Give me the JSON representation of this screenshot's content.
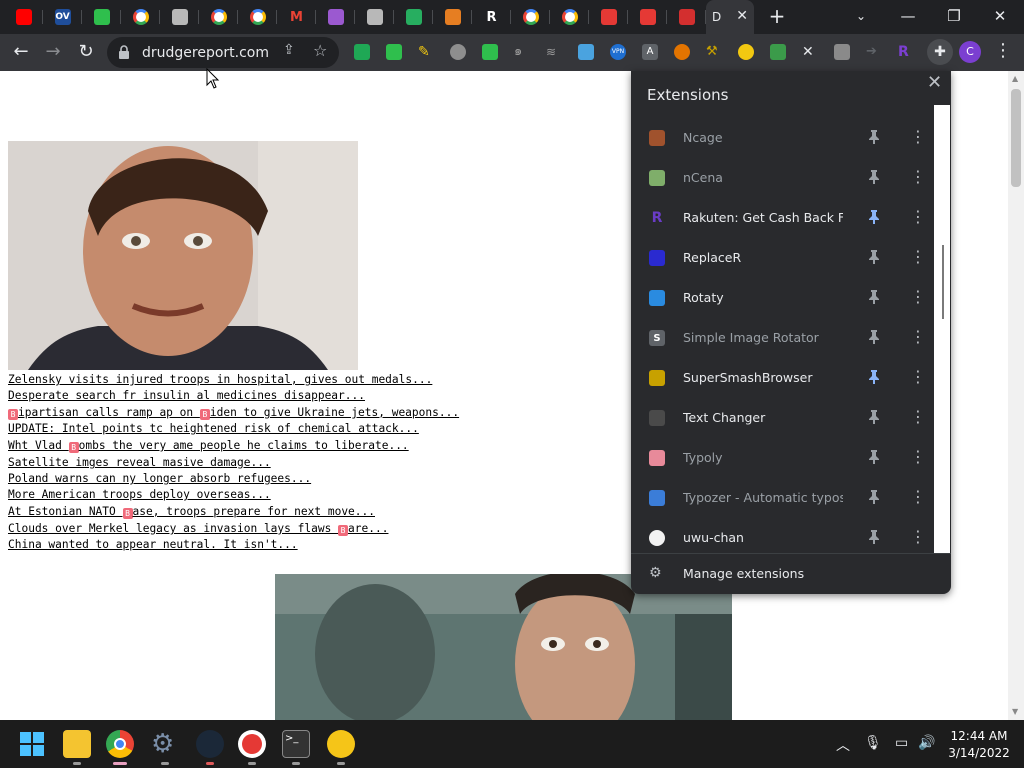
{
  "browser": {
    "active_tab_title": "D",
    "url": "drudgereport.com",
    "window_controls": {
      "minimize": "—",
      "maximize": "❐",
      "close": "✕"
    }
  },
  "tabs": [
    {
      "icon": "youtube-icon",
      "color": "#ff0000"
    },
    {
      "icon": "ov-icon",
      "label": "OV",
      "color": "#1f4e9b"
    },
    {
      "icon": "chat-icon",
      "color": "#2fbf4d"
    },
    {
      "icon": "google-icon",
      "color": "#ffffff"
    },
    {
      "icon": "bag-icon",
      "color": "#b8b8b8"
    },
    {
      "icon": "google-icon",
      "color": "#ffffff"
    },
    {
      "icon": "google-icon",
      "color": "#ffffff"
    },
    {
      "icon": "gmail-icon",
      "label": "M",
      "color": "#ea4335"
    },
    {
      "icon": "speech-icon",
      "color": "#9b59d0"
    },
    {
      "icon": "bag-icon",
      "color": "#b8b8b8"
    },
    {
      "icon": "check-icon",
      "color": "#27ae60"
    },
    {
      "icon": "h-icon",
      "color": "#e67e22"
    },
    {
      "icon": "r-icon",
      "label": "R",
      "color": "#ffffff"
    },
    {
      "icon": "google-icon",
      "color": "#ffffff"
    },
    {
      "icon": "google-icon",
      "color": "#ffffff"
    },
    {
      "icon": "abp-icon",
      "color": "#e53935"
    },
    {
      "icon": "todoist-icon",
      "color": "#e53935"
    },
    {
      "icon": "shield-icon",
      "color": "#d32f2f"
    }
  ],
  "headlines": [
    {
      "parts": [
        "Zelensky visits injured troops in hospital, gives out medals..."
      ]
    },
    {
      "parts": [
        "Desperate search fr insulin al medicines disappear..."
      ]
    },
    {
      "parts": [
        "B",
        "ipartisan calls ramp ap on ",
        "B",
        "iden to give Ukraine jets, weapons..."
      ]
    },
    {
      "parts": [
        "UPDATE: Intel points tc heightened risk of chemical attack..."
      ]
    },
    {
      "parts": [
        "Wht Vlad ",
        "B",
        "ombs the very ame people he claims to liberate..."
      ]
    },
    {
      "parts": [
        "Satellite imges reveal masive damage..."
      ]
    },
    {
      "parts": [
        "Poland warns can ny longer absorb refugees..."
      ]
    },
    {
      "parts": [
        "More American troops deploy overseas..."
      ]
    },
    {
      "parts": [
        "At Estonian NATO ",
        "B",
        "ase, troops prepare for next move..."
      ]
    },
    {
      "parts": [
        "Clouds over Merkel legacy as invasion lays flaws ",
        "B",
        "are..."
      ]
    },
    {
      "parts": [
        "China wanted to appear neutral. It isn't..."
      ]
    }
  ],
  "extensions_panel": {
    "title": "Extensions",
    "items": [
      {
        "name": "Ncage",
        "enabled": false,
        "pinned": false,
        "icon": "face-icon",
        "color": "#a0522d"
      },
      {
        "name": "nCena",
        "enabled": false,
        "pinned": false,
        "icon": "face-icon",
        "color": "#7fae6a"
      },
      {
        "name": "Rakuten: Get Cash Back For...",
        "enabled": true,
        "pinned": true,
        "icon": "rakuten-icon",
        "label": "R",
        "color": "#6a3cc7"
      },
      {
        "name": "ReplaceR",
        "enabled": true,
        "pinned": false,
        "icon": "replacer-icon",
        "color": "#2a2ad0"
      },
      {
        "name": "Rotaty",
        "enabled": true,
        "pinned": false,
        "icon": "rotate-icon",
        "color": "#2a8be0"
      },
      {
        "name": "Simple Image Rotator",
        "enabled": false,
        "pinned": false,
        "icon": "s-icon",
        "label": "S",
        "color": "#5f6368"
      },
      {
        "name": "SuperSmashBrowser",
        "enabled": true,
        "pinned": true,
        "icon": "hammer-icon",
        "color": "#c7a100"
      },
      {
        "name": "Text Changer",
        "enabled": true,
        "pinned": false,
        "icon": "person-icon",
        "color": "#4a4a4a"
      },
      {
        "name": "Typoly",
        "enabled": false,
        "pinned": false,
        "icon": "brain-icon",
        "color": "#e88a9a"
      },
      {
        "name": "Typozer - Automatic typos",
        "enabled": false,
        "pinned": false,
        "icon": "chart-icon",
        "color": "#3b7dd8"
      },
      {
        "name": "uwu-chan",
        "enabled": true,
        "pinned": false,
        "icon": "uwu-icon",
        "color": "#f2f2f2"
      }
    ],
    "manage_label": "Manage extensions",
    "accent_pin": "#8ab4f8"
  },
  "taskbar": {
    "apps": [
      {
        "name": "start",
        "icon": "windows-icon",
        "color": "#4cc2ff",
        "running": false
      },
      {
        "name": "file-explorer",
        "icon": "folder-icon",
        "color": "#f4c430",
        "running": true
      },
      {
        "name": "chrome",
        "icon": "chrome-icon",
        "color": "#4285f4",
        "running": true
      },
      {
        "name": "settings",
        "icon": "gear-icon",
        "color": "#7a8ea8",
        "running": true
      },
      {
        "name": "steam",
        "icon": "steam-icon",
        "color": "#1b2838",
        "running": true
      },
      {
        "name": "recorder",
        "icon": "record-icon",
        "color": "#e53935",
        "running": true
      },
      {
        "name": "terminal",
        "icon": "terminal-icon",
        "color": "#333333",
        "running": true
      },
      {
        "name": "app",
        "icon": "app-icon",
        "color": "#f5c518",
        "running": true
      }
    ],
    "time": "12:44 AM",
    "date": "3/14/2022"
  }
}
